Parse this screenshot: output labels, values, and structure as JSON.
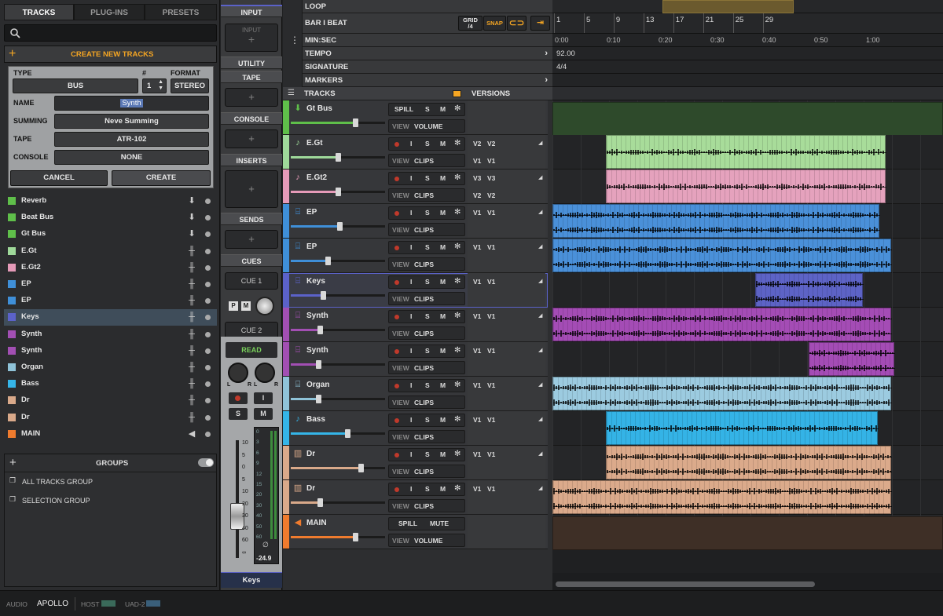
{
  "browser": {
    "tabs": [
      "TRACKS",
      "PLUG-INS",
      "PRESETS"
    ],
    "create_header": "CREATE NEW TRACKS",
    "form": {
      "type_label": "TYPE",
      "type_value": "BUS",
      "count_label": "#",
      "count_value": "1",
      "format_label": "FORMAT",
      "format_value": "STEREO",
      "name_label": "NAME",
      "name_value": "Synth",
      "summing_label": "SUMMING",
      "summing_value": "Neve Summing",
      "tape_label": "TAPE",
      "tape_value": "ATR-102",
      "console_label": "CONSOLE",
      "console_value": "NONE",
      "cancel": "CANCEL",
      "create": "CREATE"
    },
    "track_list": [
      {
        "name": "Reverb",
        "color": "#5fbf4a",
        "icon": "bus-arrow-icon"
      },
      {
        "name": "Beat Bus",
        "color": "#5fbf4a",
        "icon": "bus-arrow-icon"
      },
      {
        "name": "Gt Bus",
        "color": "#5fbf4a",
        "icon": "bus-arrow-icon"
      },
      {
        "name": "E.Gt",
        "color": "#9fd99a",
        "icon": "waveform-icon"
      },
      {
        "name": "E.Gt2",
        "color": "#e59ab8",
        "icon": "waveform-icon"
      },
      {
        "name": "EP",
        "color": "#3f8fd8",
        "icon": "waveform-icon"
      },
      {
        "name": "EP",
        "color": "#3f8fd8",
        "icon": "waveform-icon"
      },
      {
        "name": "Keys",
        "color": "#5b62c9",
        "icon": "waveform-icon"
      },
      {
        "name": "Synth",
        "color": "#a24fb3",
        "icon": "waveform-icon"
      },
      {
        "name": "Synth",
        "color": "#a24fb3",
        "icon": "waveform-icon"
      },
      {
        "name": "Organ",
        "color": "#8fc3d8",
        "icon": "waveform-icon"
      },
      {
        "name": "Bass",
        "color": "#35b5e8",
        "icon": "waveform-icon"
      },
      {
        "name": "Dr",
        "color": "#d9a98a",
        "icon": "waveform-icon"
      },
      {
        "name": "Dr",
        "color": "#d9a98a",
        "icon": "waveform-icon"
      },
      {
        "name": "MAIN",
        "color": "#ef7b2e",
        "icon": "speaker-icon"
      }
    ],
    "groups_label": "GROUPS",
    "groups": [
      "ALL TRACKS GROUP",
      "SELECTION GROUP"
    ]
  },
  "strip": {
    "sections": [
      "INPUT",
      "UTILITY",
      "TAPE",
      "CONSOLE",
      "INSERTS",
      "SENDS",
      "CUES"
    ],
    "input_slot": "INPUT",
    "cue1": "CUE 1",
    "cue2": "CUE 2",
    "p_label": "P",
    "m_label": "M",
    "automation": "READ",
    "l_label": "L",
    "r_label": "R",
    "rec_i_label": "I",
    "solo_label": "S",
    "mute_label": "M",
    "fader_scale": [
      "10",
      "5",
      "0",
      "5",
      "10",
      "20",
      "30",
      "40",
      "60",
      "∞"
    ],
    "meter_scale": [
      "0",
      "3",
      "6",
      "9",
      "12",
      "15",
      "20",
      "30",
      "40",
      "50",
      "60"
    ],
    "phase": "∅",
    "level": "-24.9",
    "track_name": "Keys"
  },
  "header": {
    "loop": "LOOP",
    "bar_beat": "BAR I BEAT",
    "grid_label": "GRID",
    "grid_value": "/4",
    "snap": "SNAP",
    "min_sec": "MIN:SEC",
    "tempo": "TEMPO",
    "tempo_value": "92.00",
    "signature": "SIGNATURE",
    "signature_value": "4/4",
    "markers": "MARKERS",
    "tracks": "TRACKS",
    "versions": "VERSIONS",
    "bars": [
      "1",
      "5",
      "9",
      "13",
      "17",
      "21",
      "25",
      "29"
    ],
    "times": [
      "0:00",
      "0:10",
      "0:20",
      "0:30",
      "0:40",
      "0:50",
      "1:00"
    ]
  },
  "track_labels": {
    "spill": "SPILL",
    "s": "S",
    "m": "M",
    "i": "I",
    "view": "VIEW",
    "volume": "VOLUME",
    "clips": "CLIPS",
    "mute": "MUTE"
  },
  "tracks": [
    {
      "name": "Gt Bus",
      "color": "#5fbf4a",
      "kind": "bus",
      "icon": "bus-arrow-icon",
      "fader": 0.68,
      "versions": [],
      "clips": [
        {
          "start": 0,
          "end": 1,
          "color": "#2e4a2b",
          "waves": 0
        }
      ]
    },
    {
      "name": "E.Gt",
      "color": "#9fd99a",
      "kind": "audio",
      "icon": "guitar-icon",
      "fader": 0.5,
      "versions": [
        "V2",
        "V2",
        "V1",
        "V1"
      ],
      "clips": [
        {
          "start": 0.136,
          "end": 0.853,
          "color": "#a8dc9a",
          "waves": 1
        }
      ]
    },
    {
      "name": "E.Gt2",
      "color": "#e59ab8",
      "kind": "audio",
      "icon": "guitar-icon",
      "fader": 0.5,
      "versions": [
        "V3",
        "V3",
        "V2",
        "V2"
      ],
      "clips": [
        {
          "start": 0.136,
          "end": 0.853,
          "color": "#e5a2bd",
          "waves": 1
        }
      ]
    },
    {
      "name": "EP",
      "color": "#3f8fd8",
      "kind": "audio",
      "icon": "keys-icon",
      "fader": 0.52,
      "versions": [
        "V1",
        "V1"
      ],
      "clips": [
        {
          "start": 0,
          "end": 0.837,
          "color": "#4a90d9",
          "waves": 2
        }
      ]
    },
    {
      "name": "EP",
      "color": "#3f8fd8",
      "kind": "audio",
      "icon": "keys-icon",
      "fader": 0.39,
      "versions": [
        "V1",
        "V1"
      ],
      "clips": [
        {
          "start": 0,
          "end": 0.867,
          "color": "#4a90d9",
          "waves": 2
        }
      ]
    },
    {
      "name": "Keys",
      "color": "#5b62c9",
      "kind": "audio",
      "icon": "keys-icon",
      "fader": 0.34,
      "versions": [
        "V1",
        "V1"
      ],
      "clips": [
        {
          "start": 0.519,
          "end": 0.795,
          "color": "#5d63c6",
          "waves": 2
        }
      ]
    },
    {
      "name": "Synth",
      "color": "#a24fb3",
      "kind": "audio",
      "icon": "keys-icon",
      "fader": 0.31,
      "versions": [
        "V1",
        "V1"
      ],
      "clips": [
        {
          "start": 0,
          "end": 0.867,
          "color": "#a44cb5",
          "waves": 2
        }
      ]
    },
    {
      "name": "Synth",
      "color": "#a24fb3",
      "kind": "audio",
      "icon": "keys-icon",
      "fader": 0.29,
      "versions": [
        "V1",
        "V1"
      ],
      "clips": [
        {
          "start": 0.656,
          "end": 0.875,
          "color": "#a44cb5",
          "waves": 2
        }
      ]
    },
    {
      "name": "Organ",
      "color": "#8fc3d8",
      "kind": "audio",
      "icon": "keys-icon",
      "fader": 0.29,
      "versions": [
        "V1",
        "V1"
      ],
      "clips": [
        {
          "start": 0,
          "end": 0.867,
          "color": "#9ccbe0",
          "waves": 2
        }
      ]
    },
    {
      "name": "Bass",
      "color": "#35b5e8",
      "kind": "audio",
      "icon": "guitar-icon",
      "fader": 0.6,
      "versions": [
        "V1",
        "V1"
      ],
      "clips": [
        {
          "start": 0.136,
          "end": 0.833,
          "color": "#34b3e6",
          "waves": 1
        }
      ]
    },
    {
      "name": "Dr",
      "color": "#d9a98a",
      "kind": "audio",
      "icon": "drum-icon",
      "fader": 0.74,
      "versions": [
        "V1",
        "V1"
      ],
      "clips": [
        {
          "start": 0.136,
          "end": 0.867,
          "color": "#dbaa8b",
          "waves": 2
        }
      ]
    },
    {
      "name": "Dr",
      "color": "#d9a98a",
      "kind": "audio",
      "icon": "drum-icon",
      "fader": 0.31,
      "versions": [
        "V1",
        "V1"
      ],
      "clips": [
        {
          "start": 0,
          "end": 0.867,
          "color": "#dbaa8b",
          "waves": 2
        }
      ]
    },
    {
      "name": "MAIN",
      "color": "#ef7b2e",
      "kind": "main",
      "icon": "speaker-icon",
      "fader": 0.68,
      "versions": [],
      "clips": [
        {
          "start": 0,
          "end": 1,
          "color": "#3e2f26",
          "waves": 0
        }
      ]
    }
  ],
  "statusbar": {
    "audio": "AUDIO",
    "device": "APOLLO",
    "host": "HOST",
    "uad": "UAD-2"
  },
  "colors": {
    "accent": "#f5a623",
    "selected_track_border": "#5b62c9"
  }
}
